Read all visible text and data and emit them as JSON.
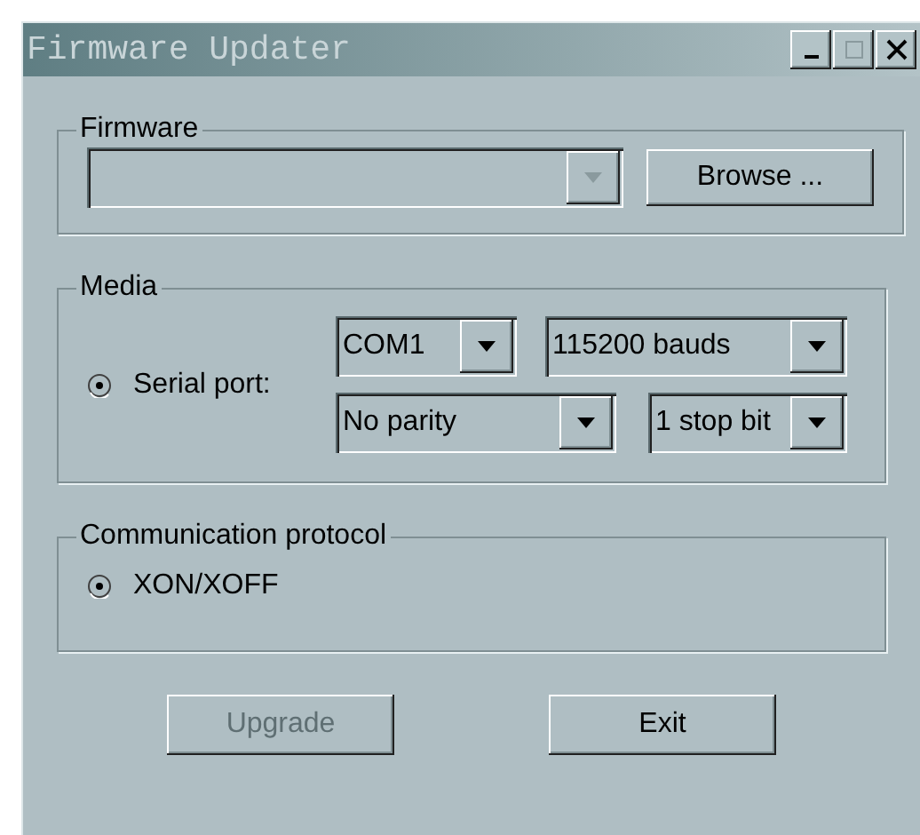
{
  "window": {
    "title": "Firmware Updater"
  },
  "firmware": {
    "label": "Firmware",
    "file": {
      "disabled": true
    },
    "browse": "Browse ..."
  },
  "media": {
    "label": "Media",
    "serial": {
      "label": "Serial port:",
      "selected": true
    },
    "selects": [
      {
        "value": "COM1",
        "disabled": false
      },
      {
        "value": "115200 bauds",
        "disabled": false
      },
      {
        "value": "No parity",
        "disabled": false
      },
      {
        "value": "1 stop bit",
        "disabled": false
      }
    ]
  },
  "protocol": {
    "label": "Communication protocol",
    "options": [
      {
        "label": "XON/XOFF",
        "selected": true
      }
    ]
  },
  "buttons": [
    {
      "label": "Upgrade",
      "disabled": true
    },
    {
      "label": "Exit",
      "disabled": false
    }
  ]
}
